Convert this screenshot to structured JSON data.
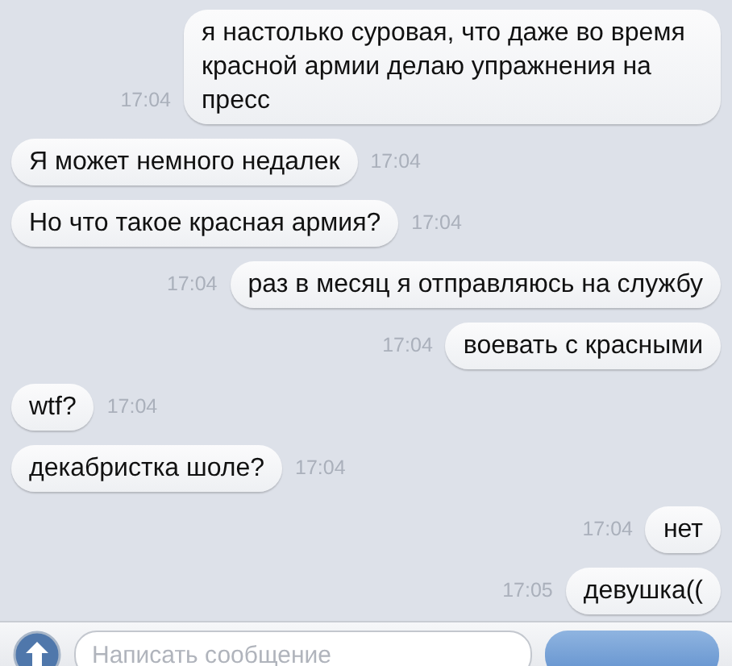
{
  "messages": [
    {
      "kind": "outgoing",
      "text": "я настолько суровая, что даже во время красной армии делаю упражнения на пресс",
      "time": "17:04"
    },
    {
      "kind": "incoming",
      "text": "Я может немного недалек",
      "time": "17:04"
    },
    {
      "kind": "incoming",
      "text": "Но что такое красная армия?",
      "time": "17:04"
    },
    {
      "kind": "outgoing",
      "text": "раз в месяц я отправляюсь на службу",
      "time": "17:04"
    },
    {
      "kind": "outgoing",
      "text": "воевать с красными",
      "time": "17:04"
    },
    {
      "kind": "incoming",
      "text": "wtf?",
      "time": "17:04"
    },
    {
      "kind": "incoming",
      "text": "декабристка шоле?",
      "time": "17:04"
    },
    {
      "kind": "outgoing",
      "text": "нет",
      "time": "17:04"
    },
    {
      "kind": "outgoing",
      "text": "девушка((",
      "time": "17:05"
    }
  ],
  "composer": {
    "placeholder": "Написать сообщение"
  }
}
